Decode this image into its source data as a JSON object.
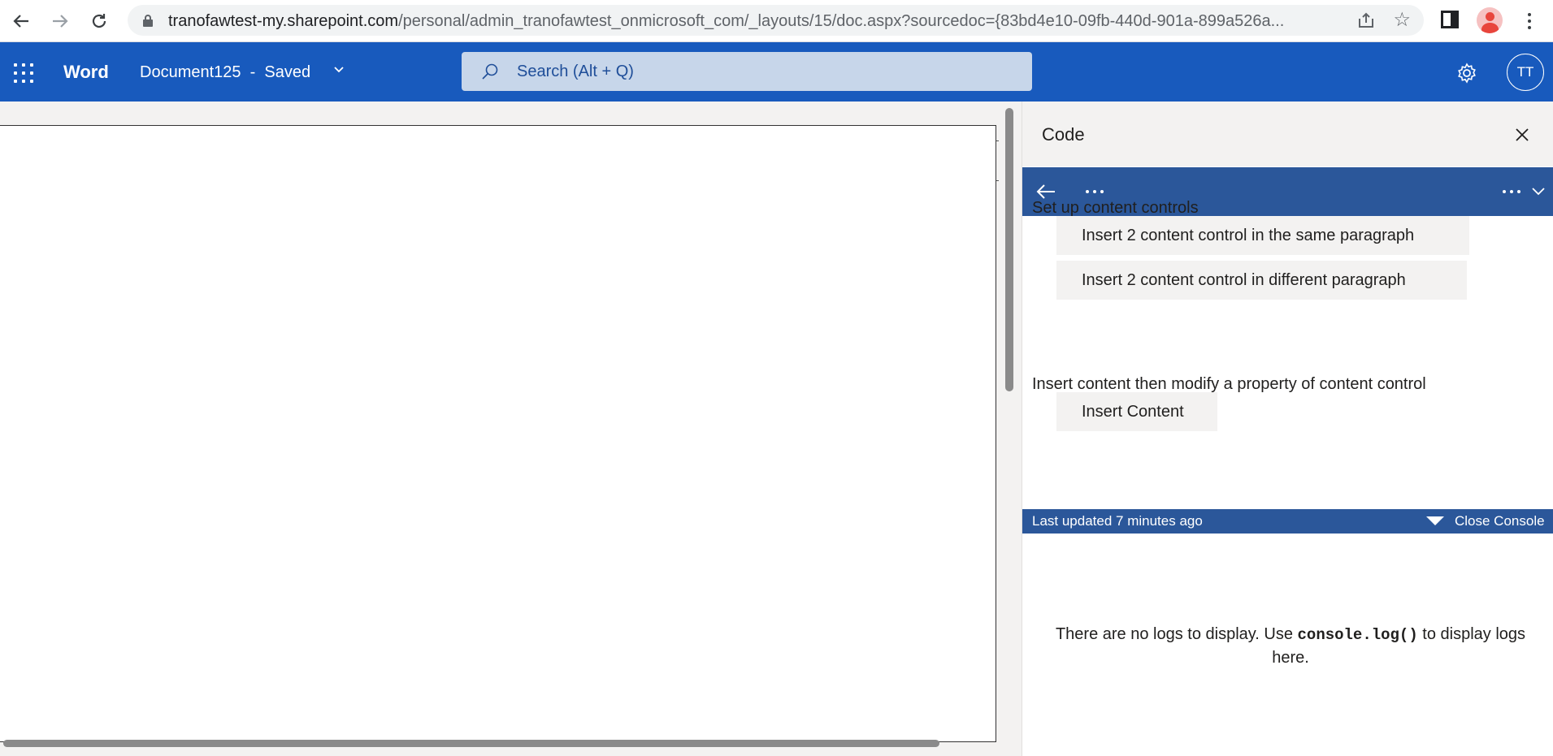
{
  "browser": {
    "url_host": "tranofawtest-my.sharepoint.com",
    "url_path": "/personal/admin_tranofawtest_onmicrosoft_com/_layouts/15/doc.aspx?sourcedoc={83bd4e10-09fb-440d-901a-899a526a..."
  },
  "word": {
    "app_name": "Word",
    "doc_title": "Document125  -  Saved",
    "search_placeholder": "Search (Alt + Q)",
    "avatar_initials": "TT"
  },
  "pane": {
    "title": "Code",
    "section1_label": "Set up content controls",
    "btn_same_paragraph": "Insert 2 content control in the same paragraph",
    "btn_different_paragraph": "Insert 2 content control in different paragraph",
    "section2_label": "Insert content then modify a property of content control",
    "btn_insert_content": "Insert Content",
    "console": {
      "last_updated": "Last updated 7 minutes ago",
      "close_label": "Close Console",
      "empty_prefix": "There are no logs to display. Use ",
      "empty_code": "console.log()",
      "empty_suffix": " to display logs here."
    }
  },
  "colors": {
    "word_blue": "#185abd",
    "pane_nav_blue": "#2b579a"
  }
}
